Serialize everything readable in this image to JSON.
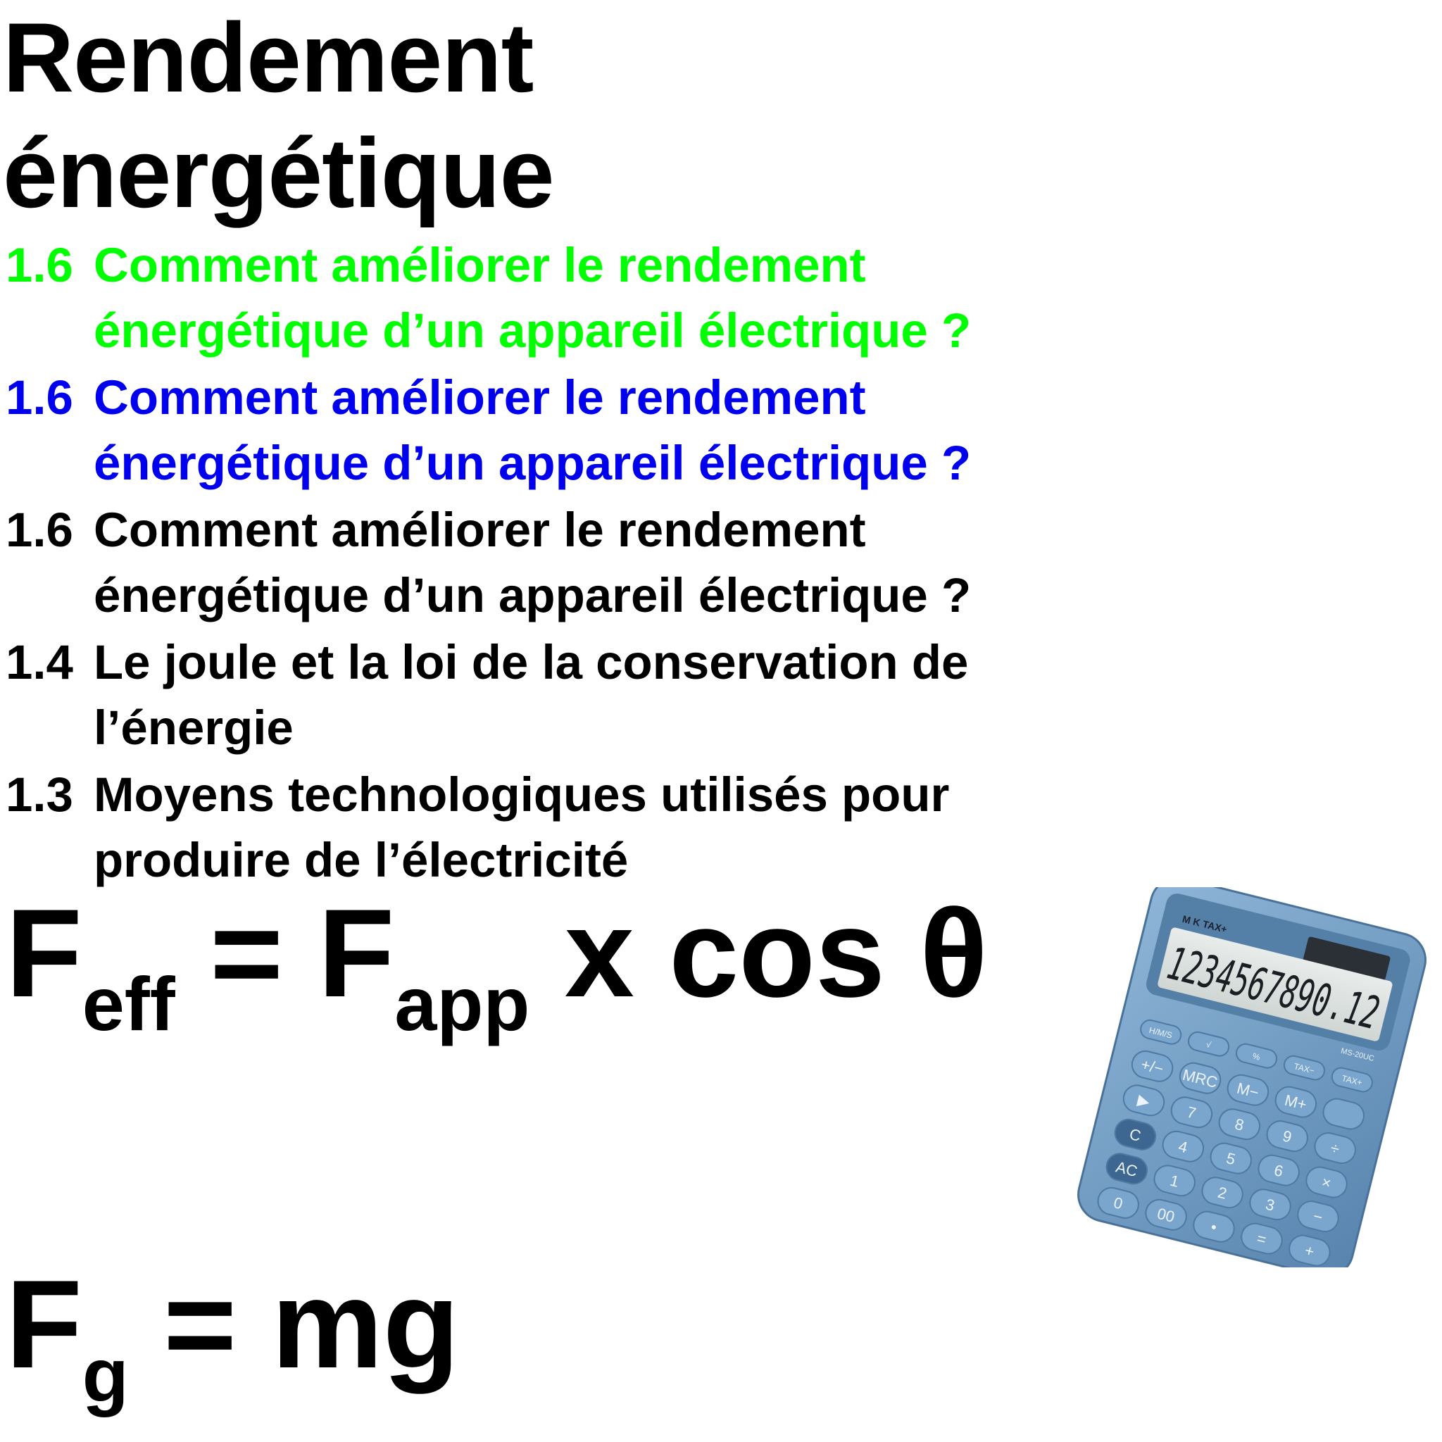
{
  "title": {
    "line1": "Rendement",
    "line2": "énergétique"
  },
  "items": [
    {
      "num": "1.6",
      "line1": "Comment améliorer le rendement",
      "line2": "énergétique d’un appareil électrique ?",
      "color": "#00ff00"
    },
    {
      "num": "1.6",
      "line1": "Comment améliorer le rendement",
      "line2": "énergétique d’un appareil électrique ?",
      "color": "#0000ee"
    },
    {
      "num": "1.6",
      "line1": "Comment améliorer le rendement",
      "line2": "énergétique d’un appareil électrique ?",
      "color": "#000000"
    },
    {
      "num": "1.4",
      "line1": "Le joule et la loi de la conservation de",
      "line2": "l’énergie",
      "color": "#000000"
    },
    {
      "num": "1.3",
      "line1": "Moyens technologiques utilisés pour",
      "line2": "produire de l’électricité",
      "color": "#000000"
    }
  ],
  "formula1": {
    "f": "F",
    "sub1": "eff",
    "eq": " = F",
    "sub2": "app",
    "rest": " x cos θ"
  },
  "formula2": {
    "f": "F",
    "sub": "g",
    "rest": " = mg"
  },
  "calculator": {
    "display": "1234567890.12",
    "indicators": "M K TAX+",
    "model": "MS-20UC",
    "body_color": "#6f9cc3",
    "keys": [
      [
        "H/M/S",
        "√",
        "%",
        "TAX−",
        "TAX+"
      ],
      [
        "+/−",
        "MRC",
        "M−",
        "M+",
        ""
      ],
      [
        "▶",
        "7",
        "8",
        "9",
        "÷"
      ],
      [
        "C",
        "4",
        "5",
        "6",
        "×"
      ],
      [
        "AC",
        "1",
        "2",
        "3",
        "−"
      ],
      [
        "0",
        "00",
        "•",
        "=",
        "+"
      ]
    ]
  }
}
